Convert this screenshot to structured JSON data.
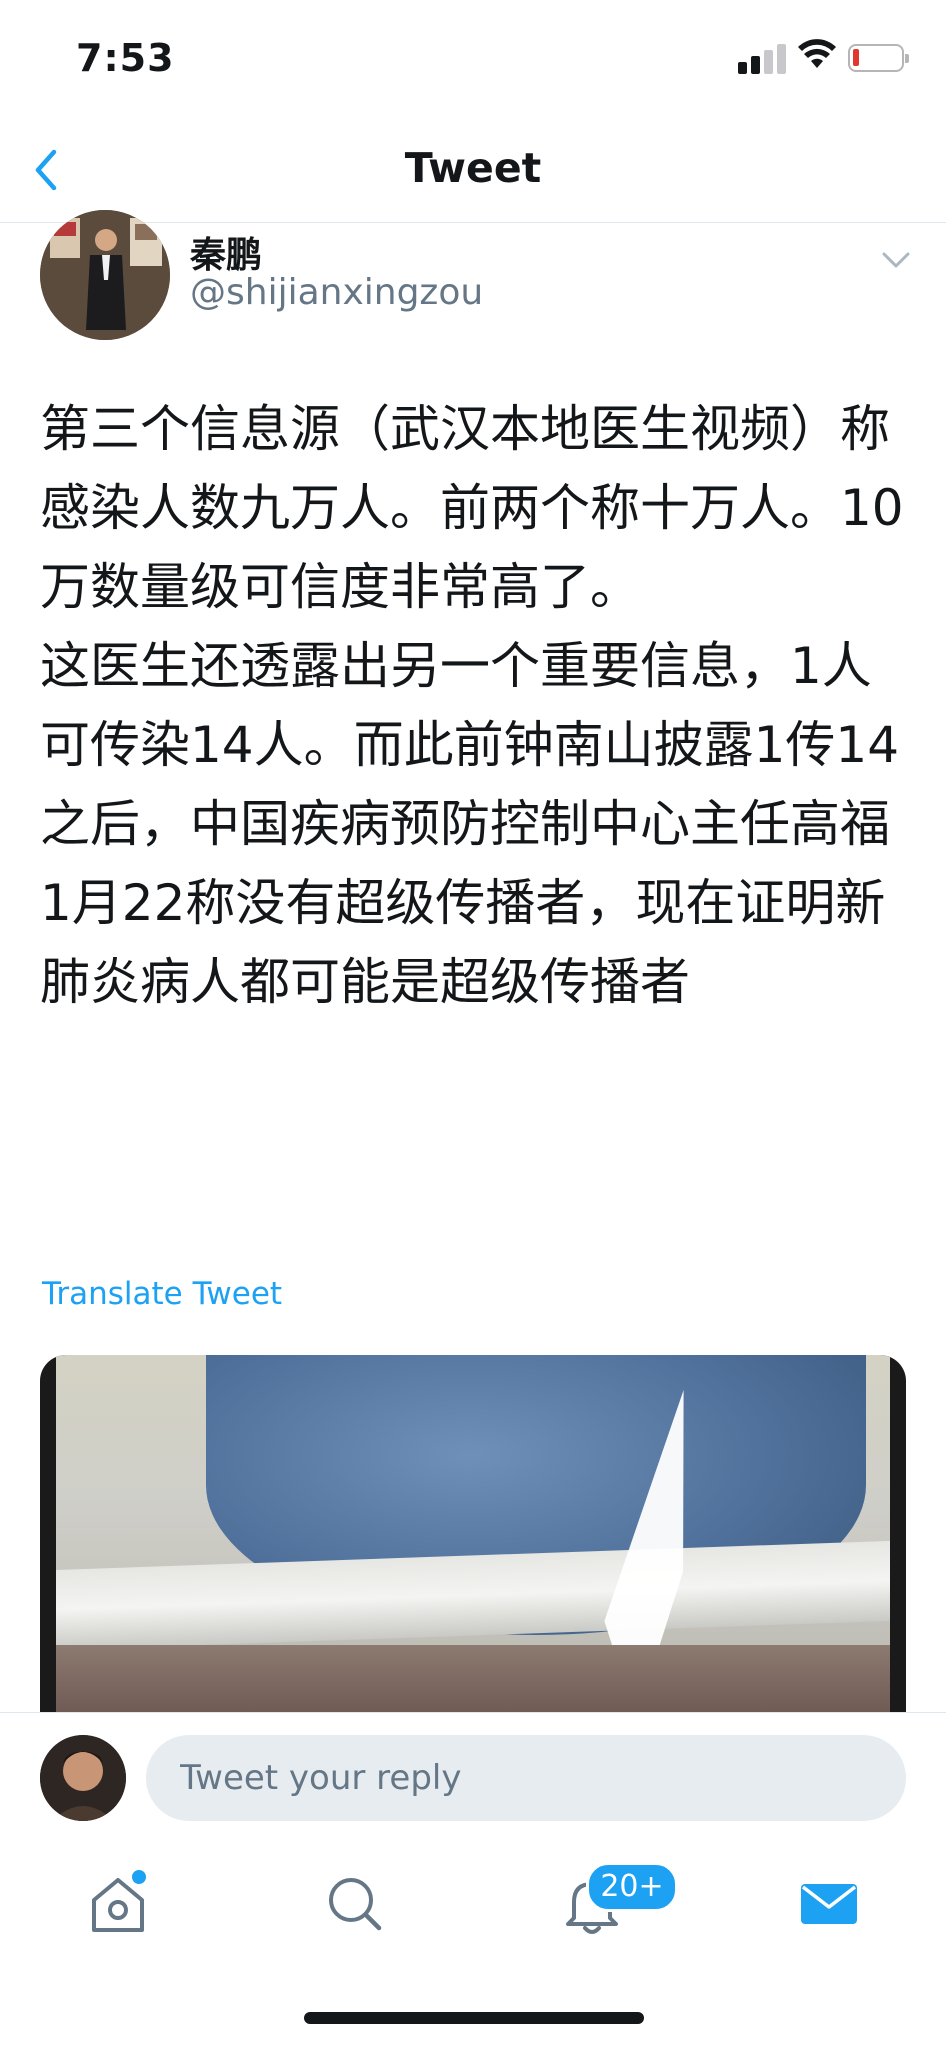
{
  "status_bar": {
    "time": "7:53"
  },
  "nav": {
    "title": "Tweet"
  },
  "tweet": {
    "author_name": "秦鹏",
    "author_handle": "@shijianxingzou",
    "paragraphs": [
      "第三个信息源（武汉本地医生视频）称感染人数九万人。前两个称十万人。10万数量级可信度非常高了。",
      "这医生还透露出另一个重要信息，1人可传染14人。而此前钟南山披露1传14之后，中国疾病预防控制中心主任高福1月22称没有超级传播者，现在证明新肺炎病人都可能是超级传播者"
    ],
    "translate_label": "Translate Tweet"
  },
  "reply": {
    "placeholder": "Tweet your reply"
  },
  "tabs": {
    "notifications_badge": "20+"
  },
  "colors": {
    "accent": "#1da1f2",
    "text": "#14171a",
    "secondary": "#657786"
  },
  "icons": [
    "back-chevron-icon",
    "caret-down-icon",
    "home-icon",
    "search-icon",
    "bell-icon",
    "mail-icon",
    "signal-icon",
    "wifi-icon",
    "battery-icon"
  ]
}
